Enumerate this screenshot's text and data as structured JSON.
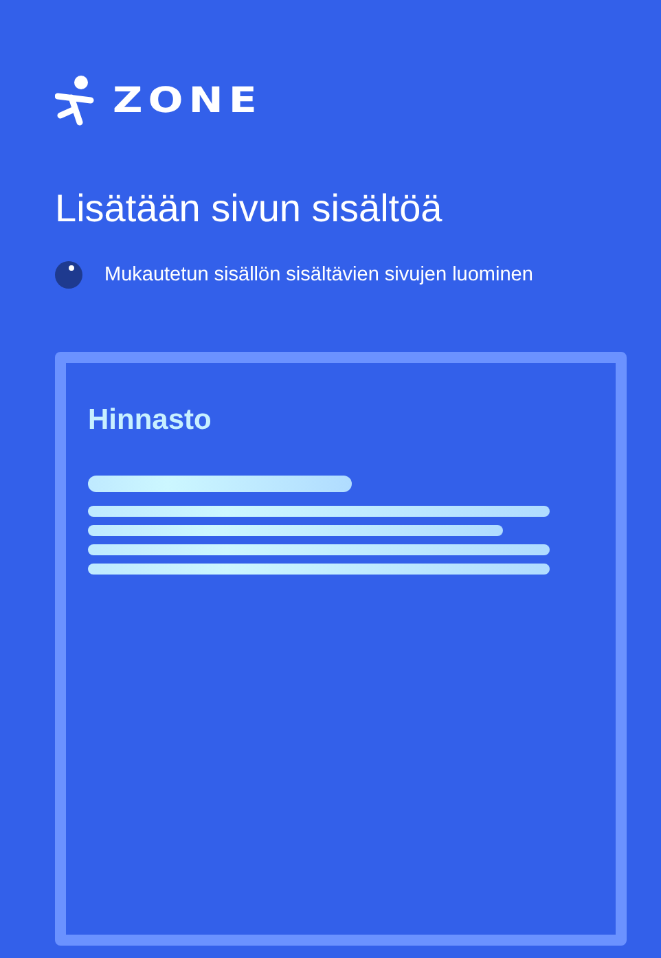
{
  "logo": {
    "text": "ZONE"
  },
  "title": "Lisätään sivun sisältöä",
  "status": {
    "text": "Mukautetun sisällön sisältävien sivujen luominen"
  },
  "preview_card": {
    "title": "Hinnasto"
  }
}
